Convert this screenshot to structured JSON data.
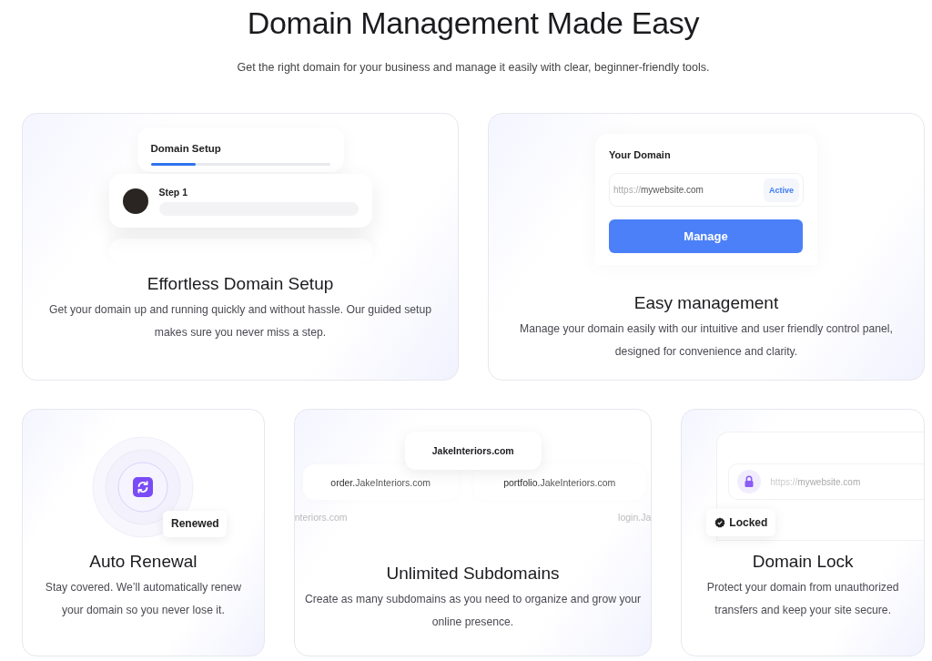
{
  "header": {
    "title": "Domain Management Made Easy",
    "subtitle": "Get the right domain for your business and manage it easily with clear, beginner-friendly tools."
  },
  "features": [
    {
      "kind": "setup",
      "panel_title": "Domain Setup",
      "progress": {
        "level": 0.25
      },
      "step_label": "Step 1",
      "title": "Effortless Domain Setup",
      "description": "Get your domain up and running quickly and without hassle. Our guided setup makes sure you never miss a step."
    },
    {
      "kind": "manage",
      "panel_title": "Your Domain",
      "url_prefix": "https://",
      "url_host": "mywebsite.com",
      "status": "Active",
      "button": "Manage",
      "title": "Easy management",
      "description": "Manage your domain easily with our intuitive and user friendly control panel, designed for convenience and clarity."
    },
    {
      "kind": "renewal",
      "badge": "Renewed",
      "title": "Auto Renewal",
      "description": "Stay covered. We’ll automatically renew your domain so you never lose it."
    },
    {
      "kind": "subdomains",
      "root": "JakeInteriors.com",
      "subdomains": [
        {
          "prefix": "order.",
          "domain": "JakeInteriors.com"
        },
        {
          "prefix": "portfolio.",
          "domain": "JakeInteriors.com"
        }
      ],
      "faded": [
        "nteriors.com",
        "login.Ja"
      ],
      "title": "Unlimited Subdomains",
      "description": "Create as many subdomains as you need to organize and grow your online presence."
    },
    {
      "kind": "lock",
      "url_prefix": "https://",
      "url_host": "mywebsite.com",
      "badge": "Locked",
      "title": "Domain Lock",
      "description": "Protect your domain from unauthorized transfers and keep your site secure."
    }
  ]
}
